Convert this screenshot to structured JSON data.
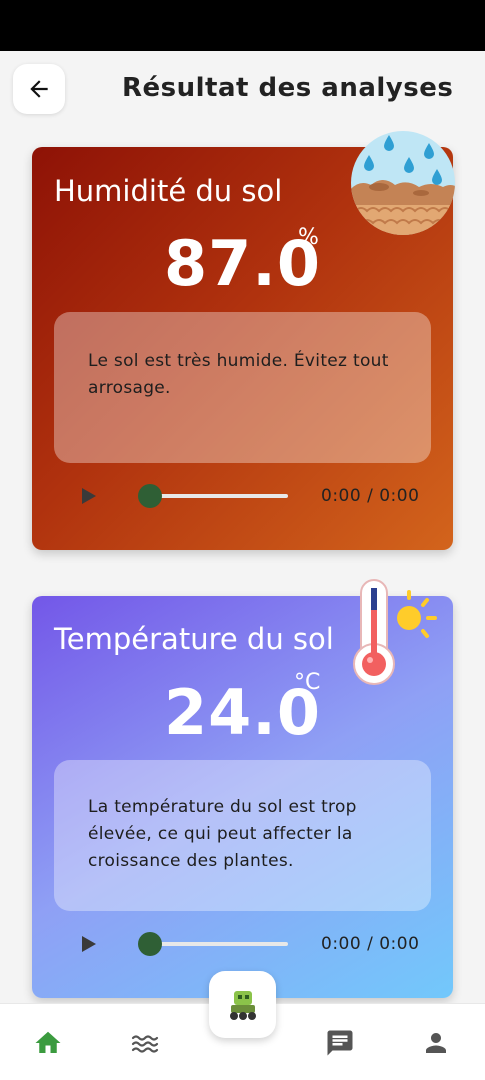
{
  "header": {
    "title": "Résultat des analyses",
    "back_icon": "arrow-left-icon"
  },
  "cards": [
    {
      "title": "Humidité du sol",
      "value": "87.0",
      "unit": "%",
      "message": "Le sol est très humide. Évitez tout arrosage.",
      "icon": "soil-water-icon",
      "time_current": "0:00",
      "time_separator": " / ",
      "time_total": "0:00",
      "progress": 0,
      "gradient": [
        "#8e1206",
        "#d3641c"
      ]
    },
    {
      "title": "Température du sol",
      "value": "24.0",
      "unit": "°C",
      "message": "La température du sol est trop élevée, ce qui peut affecter la croissance des plantes.",
      "icon": "thermometer-sun-icon",
      "time_current": "0:00",
      "time_separator": " / ",
      "time_total": "0:00",
      "progress": 0,
      "gradient": [
        "#7357e8",
        "#72c8fb"
      ]
    }
  ],
  "nav": {
    "items": [
      "home-icon",
      "waves-icon",
      "chat-icon",
      "profile-icon"
    ],
    "active": "home-icon",
    "active_color": "#3b9b3f",
    "inactive_color": "#555555",
    "fab_icon": "robot-icon"
  },
  "colors": {
    "player_thumb": "#2f5f35"
  }
}
